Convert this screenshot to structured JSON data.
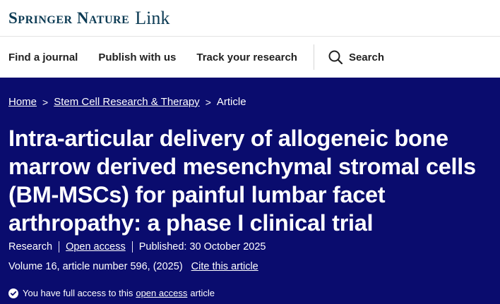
{
  "header": {
    "logo_main": "Springer Nature",
    "logo_link": "Link"
  },
  "nav": {
    "items": [
      {
        "label": "Find a journal"
      },
      {
        "label": "Publish with us"
      },
      {
        "label": "Track your research"
      }
    ],
    "search_label": "Search",
    "search_icon": "search-icon"
  },
  "breadcrumb": {
    "items": [
      "Home",
      "Stem Cell Research & Therapy"
    ],
    "current": "Article",
    "separator": ">"
  },
  "article": {
    "title": "Intra-articular delivery of allogeneic bone marrow derived mesenchymal stromal cells (BM-MSCs) for painful lumbar facet arthropathy: a phase I clinical trial",
    "type": "Research",
    "access": "Open access",
    "published": "Published: 30 October 2025",
    "volume_info": "Volume 16, article number 596, (2025)",
    "cite_label": "Cite this article"
  },
  "access_notice": {
    "prefix": "You have full access to this",
    "link": "open access",
    "suffix": "article",
    "icon": "check-circle-icon"
  },
  "colors": {
    "hero_bg": "#0a0c6e",
    "logo": "#0c3b54",
    "text": "#222222"
  }
}
